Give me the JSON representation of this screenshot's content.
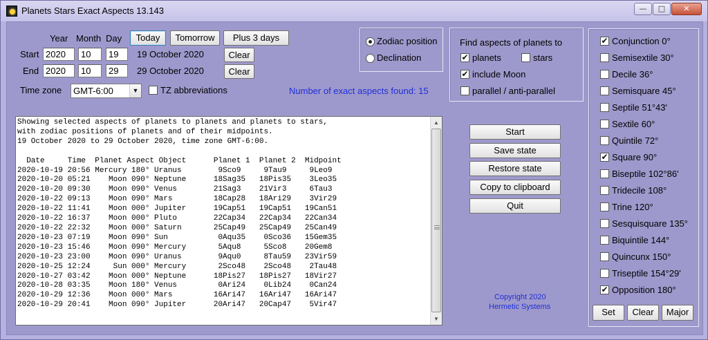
{
  "window": {
    "title": "Planets Stars Exact Aspects 13.143",
    "minimize_glyph": "—",
    "maximize_glyph": "□",
    "close_glyph": "✕"
  },
  "dates": {
    "headers": {
      "year": "Year",
      "month": "Month",
      "day": "Day"
    },
    "quick_buttons": {
      "today": "Today",
      "tomorrow": "Tomorrow",
      "plus3": "Plus 3 days"
    },
    "start": {
      "label": "Start",
      "year": "2020",
      "month": "10",
      "day": "19",
      "text": "19 October 2020",
      "clear": "Clear"
    },
    "end": {
      "label": "End",
      "year": "2020",
      "month": "10",
      "day": "29",
      "text": "29 October 2020",
      "clear": "Clear"
    },
    "timezone": {
      "label": "Time zone",
      "value": "GMT-6:00",
      "arrow": "▼"
    },
    "tz_abbrev": {
      "label": "TZ abbreviations",
      "checked": false
    }
  },
  "position_mode": {
    "zodiac": {
      "label": "Zodiac position",
      "selected": true
    },
    "declination": {
      "label": "Declination",
      "selected": false
    }
  },
  "find": {
    "title": "Find aspects of planets to",
    "planets": {
      "label": "planets",
      "checked": true
    },
    "stars": {
      "label": "stars",
      "checked": false
    },
    "include_moon": {
      "label": "include Moon",
      "checked": true
    },
    "parallel": {
      "label": "parallel / anti-parallel",
      "checked": false
    }
  },
  "status": {
    "found_text": "Number of exact aspects found: 15"
  },
  "output": {
    "lines": [
      "Showing selected aspects of planets to planets and planets to stars,",
      "with zodiac positions of planets and of their midpoints.",
      "19 October 2020 to 29 October 2020, time zone GMT-6:00.",
      "",
      "  Date     Time  Planet Aspect Object      Planet 1  Planet 2  Midpoint",
      "2020-10-19 20:56 Mercury 180° Uranus        9Sco9     9Tau9     9Leo9",
      "2020-10-20 05:21    Moon 090° Neptune      18Sag35   18Pis35    3Leo35",
      "2020-10-20 09:30    Moon 090° Venus        21Sag3    21Vir3     6Tau3",
      "2020-10-22 09:13    Moon 090° Mars         18Cap28   18Ari29    3Vir29",
      "2020-10-22 11:41    Moon 000° Jupiter      19Cap51   19Cap51   19Can51",
      "2020-10-22 16:37    Moon 000° Pluto        22Cap34   22Cap34   22Can34",
      "2020-10-22 22:32    Moon 000° Saturn       25Cap49   25Cap49   25Can49",
      "2020-10-23 07:19    Moon 090° Sun           0Aqu35    0Sco36   15Gem35",
      "2020-10-23 15:46    Moon 090° Mercury       5Aqu8     5Sco8    20Gem8",
      "2020-10-23 23:00    Moon 090° Uranus        9Aqu0     8Tau59   23Vir59",
      "2020-10-25 12:24     Sun 000° Mercury       2Sco48    2Sco48    2Tau48",
      "2020-10-27 03:42    Moon 000° Neptune      18Pis27   18Pis27   18Vir27",
      "2020-10-28 03:35    Moon 180° Venus         0Ari24    0Lib24    0Can24",
      "2020-10-29 12:36    Moon 000° Mars         16Ari47   16Ari47   16Ari47",
      "2020-10-29 20:41    Moon 090° Jupiter      20Ari47   20Cap47    5Vir47"
    ],
    "scroll_up": "▲",
    "scroll_down": "▼"
  },
  "actions": {
    "start": "Start",
    "save_state": "Save state",
    "restore_state": "Restore state",
    "copy": "Copy to clipboard",
    "quit": "Quit"
  },
  "copyright": {
    "line1": "Copyright 2020",
    "line2": "Hermetic Systems"
  },
  "aspects": [
    {
      "label": "Conjunction 0°",
      "checked": true
    },
    {
      "label": "Semisextile 30°",
      "checked": false
    },
    {
      "label": "Decile 36°",
      "checked": false
    },
    {
      "label": "Semisquare 45°",
      "checked": false
    },
    {
      "label": "Septile 51°43'",
      "checked": false
    },
    {
      "label": "Sextile 60°",
      "checked": false
    },
    {
      "label": "Quintile 72°",
      "checked": false
    },
    {
      "label": "Square 90°",
      "checked": true
    },
    {
      "label": "Biseptile 102°86'",
      "checked": false
    },
    {
      "label": "Tridecile 108°",
      "checked": false
    },
    {
      "label": "Trine 120°",
      "checked": false
    },
    {
      "label": "Sesquisquare 135°",
      "checked": false
    },
    {
      "label": "Biquintile 144°",
      "checked": false
    },
    {
      "label": "Quincunx 150°",
      "checked": false
    },
    {
      "label": "Triseptile 154°29'",
      "checked": false
    },
    {
      "label": "Opposition 180°",
      "checked": true
    }
  ],
  "aspect_buttons": {
    "set": "Set",
    "clear": "Clear",
    "major": "Major"
  },
  "check_glyph": "✔"
}
